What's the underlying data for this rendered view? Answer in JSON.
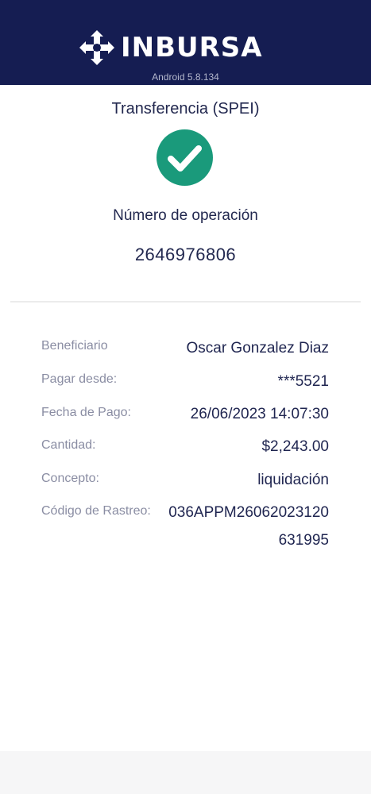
{
  "header": {
    "brand": "INBURSA",
    "version": "Android 5.8.134",
    "logo_icon": "inbursa-logo-icon",
    "background": "#151d52"
  },
  "receipt": {
    "title": "Transferencia (SPEI)",
    "status_icon": "check-circle-icon",
    "status_color": "#1a9a7b",
    "operation_label": "Número de operación",
    "operation_number": "2646976806"
  },
  "details": {
    "beneficiary_label": "Beneficiario",
    "beneficiary_value": "Oscar Gonzalez Diaz",
    "from_label": "Pagar desde:",
    "from_value": "***5521",
    "date_label": "Fecha de Pago:",
    "date_value": "26/06/2023 14:07:30",
    "amount_label": "Cantidad:",
    "amount_value": "$2,243.00",
    "concept_label": "Concepto:",
    "concept_value": "liquidación",
    "tracking_label": "Código de Rastreo:",
    "tracking_value_line1": "036APPM26062023120",
    "tracking_value_line2": "631995"
  }
}
